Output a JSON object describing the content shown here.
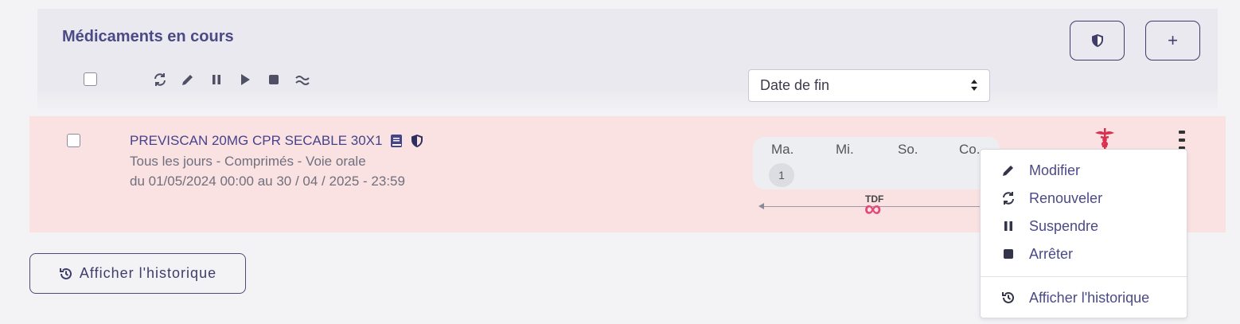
{
  "section": {
    "title": "Médicaments en cours",
    "buttons": {
      "shield_icon": "shield-icon",
      "add_label": "+"
    },
    "toolbar_icons": [
      "refresh-icon",
      "pencil-icon",
      "pause-icon",
      "play-icon",
      "stop-icon",
      "approx-icon"
    ],
    "sort_select": {
      "selected": "Date de fin"
    }
  },
  "medication": {
    "name": "PREVISCAN 20MG CPR SECABLE 30X1",
    "frequency": "Tous les jours - Comprimés - Voie orale",
    "period": "du 01/05/2024 00:00 au 30 / 04 / 2025 - 23:59",
    "schedule": {
      "days": [
        "Ma.",
        "Mi.",
        "So.",
        "Co."
      ],
      "dose": "1"
    },
    "timeline": {
      "marker_label": "TDF",
      "marker_symbol": "∞"
    }
  },
  "context_menu": {
    "items": [
      {
        "label": "Modifier",
        "icon": "pencil-icon"
      },
      {
        "label": "Renouveler",
        "icon": "refresh-icon"
      },
      {
        "label": "Suspendre",
        "icon": "pause-icon"
      },
      {
        "label": "Arrêter",
        "icon": "stop-icon"
      },
      {
        "label": "Afficher l'historique",
        "icon": "history-icon"
      }
    ]
  },
  "footer": {
    "history_button": "Afficher l'historique"
  },
  "colors": {
    "accent": "#4b4a86",
    "row_bg": "#fae2e2",
    "infinity": "#e04a78",
    "caduceus": "#d9304f"
  }
}
